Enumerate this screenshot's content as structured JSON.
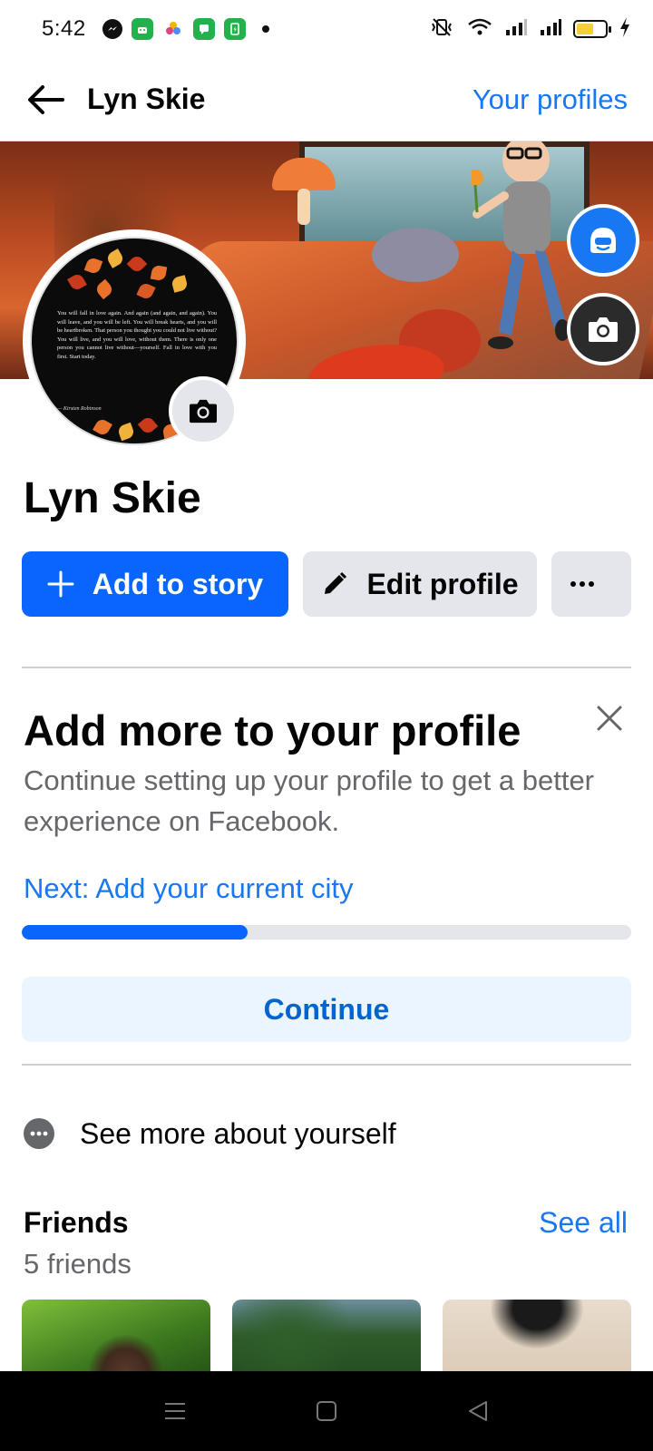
{
  "status_bar": {
    "time": "5:42",
    "icons": [
      "messenger-icon",
      "android-app-icon",
      "photos-icon",
      "messages-icon",
      "battery-saver-icon",
      "notification-dot-icon",
      "vibrate-icon",
      "wifi-icon",
      "signal-icon",
      "signal-icon",
      "battery-icon",
      "charging-icon"
    ],
    "battery_level": 0.6
  },
  "header": {
    "back_icon": "arrow-left-icon",
    "title": "Lyn Skie",
    "link": "Your profiles"
  },
  "profile_photo": {
    "quote": "You will fall in love again. And again (and again, and again). You will leave, and you will be left. You will break hearts, and you will be heartbroken. That person you thought you could not live without? You will live, and you will love, without them. There is only one person you cannot live without—yourself. Fall in love with you first. Start today.",
    "author": "— Kirsten Robinson"
  },
  "profile": {
    "name": "Lyn Skie"
  },
  "actions": {
    "add_story": "Add to story",
    "edit_profile": "Edit profile",
    "more_icon": "more-horizontal-icon"
  },
  "add_more": {
    "title": "Add more to your profile",
    "description": "Continue setting up your profile to get a better experience on Facebook.",
    "next": "Next: Add your current city",
    "progress": 0.37,
    "continue": "Continue"
  },
  "see_more": {
    "label": "See more about yourself"
  },
  "friends": {
    "title": "Friends",
    "see_all": "See all",
    "count": "5 friends"
  },
  "colors": {
    "primary_blue": "#0866ff",
    "link_blue": "#1877f2",
    "secondary_gray": "#e4e6eb",
    "text_gray": "#65676b",
    "continue_bg": "#ebf5ff"
  }
}
